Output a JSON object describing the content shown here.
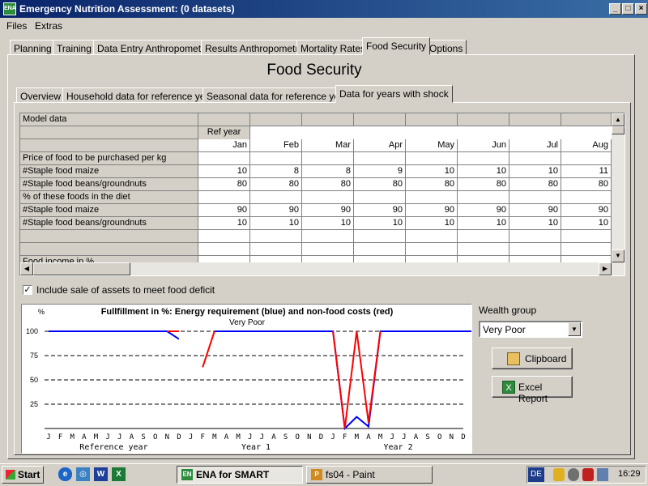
{
  "window": {
    "title": "Emergency Nutrition Assessment:  (0 datasets)",
    "app_badge": "ENA"
  },
  "menu": [
    "Files",
    "Extras"
  ],
  "main_tabs": [
    "Planning",
    "Training",
    "Data Entry Anthropometry",
    "Results Anthropometry",
    "Mortality Rates",
    "Food Security",
    "Options"
  ],
  "active_main_tab": "Food Security",
  "page_title": "Food Security",
  "sub_tabs": [
    "Overview",
    "Household data for reference year",
    "Seasonal data for reference year",
    "Data for years with shock"
  ],
  "grid": {
    "header_label": "Model data",
    "ref_year_label": "Ref year",
    "months": [
      "Jan",
      "Feb",
      "Mar",
      "Apr",
      "May",
      "Jun",
      "Jul",
      "Aug"
    ],
    "rows": [
      {
        "label": "Price of food to be purchased per kg",
        "values": [
          "",
          "",
          "",
          "",
          "",
          "",
          "",
          ""
        ]
      },
      {
        "label": "#Staple food maize",
        "values": [
          "10",
          "8",
          "8",
          "9",
          "10",
          "10",
          "10",
          "11"
        ]
      },
      {
        "label": "#Staple food beans/groundnuts",
        "values": [
          "80",
          "80",
          "80",
          "80",
          "80",
          "80",
          "80",
          "80"
        ]
      },
      {
        "label": "% of these foods in the diet",
        "values": [
          "",
          "",
          "",
          "",
          "",
          "",
          "",
          ""
        ]
      },
      {
        "label": "#Staple food maize",
        "values": [
          "90",
          "90",
          "90",
          "90",
          "90",
          "90",
          "90",
          "90"
        ]
      },
      {
        "label": "#Staple food beans/groundnuts",
        "values": [
          "10",
          "10",
          "10",
          "10",
          "10",
          "10",
          "10",
          "10"
        ]
      },
      {
        "label": "",
        "values": [
          "",
          "",
          "",
          "",
          "",
          "",
          "",
          ""
        ]
      },
      {
        "label": "",
        "values": [
          "",
          "",
          "",
          "",
          "",
          "",
          "",
          ""
        ]
      },
      {
        "label": "Food income in %",
        "values": [
          "",
          "",
          "",
          "",
          "",
          "",
          "",
          ""
        ]
      }
    ]
  },
  "include_assets": {
    "label": "Include sale of assets to meet food deficit",
    "checked": true,
    "mark": "✓"
  },
  "chart_data": {
    "type": "line",
    "title": "Fullfillment in %: Energy requirement (blue) and non-food costs (red)",
    "subtitle": "Very Poor",
    "ylabel": "%",
    "ylim": [
      0,
      100
    ],
    "yticks": [
      100,
      75,
      50,
      25
    ],
    "ytick_labels": [
      "100",
      "75",
      "50",
      "25"
    ],
    "x_month_labels": [
      "J",
      "F",
      "M",
      "A",
      "M",
      "J",
      "J",
      "A",
      "S",
      "O",
      "N",
      "D",
      "J",
      "F",
      "M",
      "A",
      "M",
      "J",
      "J",
      "A",
      "S",
      "O",
      "N",
      "D",
      "J",
      "F",
      "M",
      "A",
      "M",
      "J",
      "J",
      "A",
      "S",
      "O",
      "N",
      "D"
    ],
    "period_labels": [
      "Reference year",
      "Year 1",
      "Year 2"
    ],
    "grid": "horizontal dashed",
    "series": [
      {
        "color": "#0000ff",
        "segments": [
          {
            "x": [
              1,
              11,
              12
            ],
            "y": [
              100,
              100,
              92
            ]
          },
          {
            "x": [
              15,
              25,
              26,
              27,
              28,
              29,
              30,
              39,
              40
            ],
            "y": [
              100,
              100,
              0,
              12,
              2,
              100,
              100,
              100,
              84
            ]
          }
        ]
      },
      {
        "color": "#ff0000",
        "segments": [
          {
            "x": [
              11,
              12
            ],
            "y": [
              100,
              100
            ]
          },
          {
            "x": [
              14,
              15
            ],
            "y": [
              63,
              100
            ]
          },
          {
            "x": [
              25,
              26,
              27,
              28,
              29
            ],
            "y": [
              100,
              0,
              100,
              6,
              100
            ]
          },
          {
            "x": [
              39,
              40
            ],
            "y": [
              100,
              100
            ]
          }
        ]
      }
    ]
  },
  "wealth_group": {
    "label": "Wealth group",
    "selected": "Very Poor"
  },
  "buttons": {
    "clipboard": "Clipboard",
    "excel_report": "Excel Report"
  },
  "taskbar": {
    "start": "Start",
    "tasks": [
      "ENA for SMART",
      "fs04 - Paint"
    ],
    "lang": "DE",
    "time": "16:29"
  }
}
